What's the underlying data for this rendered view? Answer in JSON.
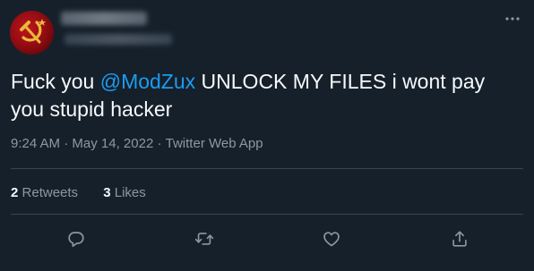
{
  "tweet": {
    "author": {
      "display_name": "",
      "handle": ""
    },
    "text_before_mention": "Fuck you ",
    "mention": "@ModZux",
    "text_after_mention": " UNLOCK MY FILES i wont pay you stupid hacker",
    "time": "9:24 AM",
    "separator": "·",
    "date": "May 14, 2022",
    "source": "Twitter Web App",
    "retweets": {
      "count": "2",
      "label": "Retweets"
    },
    "likes": {
      "count": "3",
      "label": "Likes"
    }
  },
  "icons": {
    "more": "more-dots-icon",
    "reply": "reply-icon",
    "retweet": "retweet-icon",
    "like": "heart-icon",
    "share": "share-icon"
  },
  "colors": {
    "background": "#15202b",
    "text": "#f7f9f9",
    "secondary": "#8b98a5",
    "mention": "#1d9bf0",
    "divider": "#38444d"
  }
}
